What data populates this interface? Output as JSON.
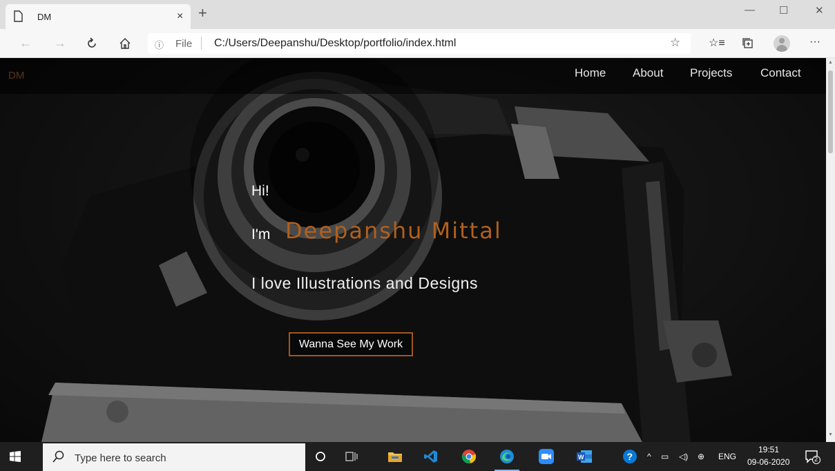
{
  "browser": {
    "tab_title": "DM",
    "close_tab": "×",
    "new_tab": "+",
    "window_controls": [
      "—",
      "☐",
      "✕"
    ],
    "file_label": "File",
    "url": "C:/Users/Deepanshu/Desktop/portfolio/index.html",
    "more": "···"
  },
  "site": {
    "logo": "DM",
    "nav": [
      "Home",
      "About",
      "Projects",
      "Contact"
    ],
    "hero": {
      "greeting": "Hi!",
      "im": "I'm",
      "name": "Deepanshu Mittal",
      "tagline": "I love Illustrations and Designs",
      "cta": "Wanna See My Work"
    },
    "colors": {
      "accent": "#b0601e",
      "logo": "#5a3418"
    }
  },
  "taskbar": {
    "search_placeholder": "Type here to search",
    "lang": "ENG",
    "time": "19:51",
    "date": "09-06-2020",
    "notification_count": "2"
  }
}
